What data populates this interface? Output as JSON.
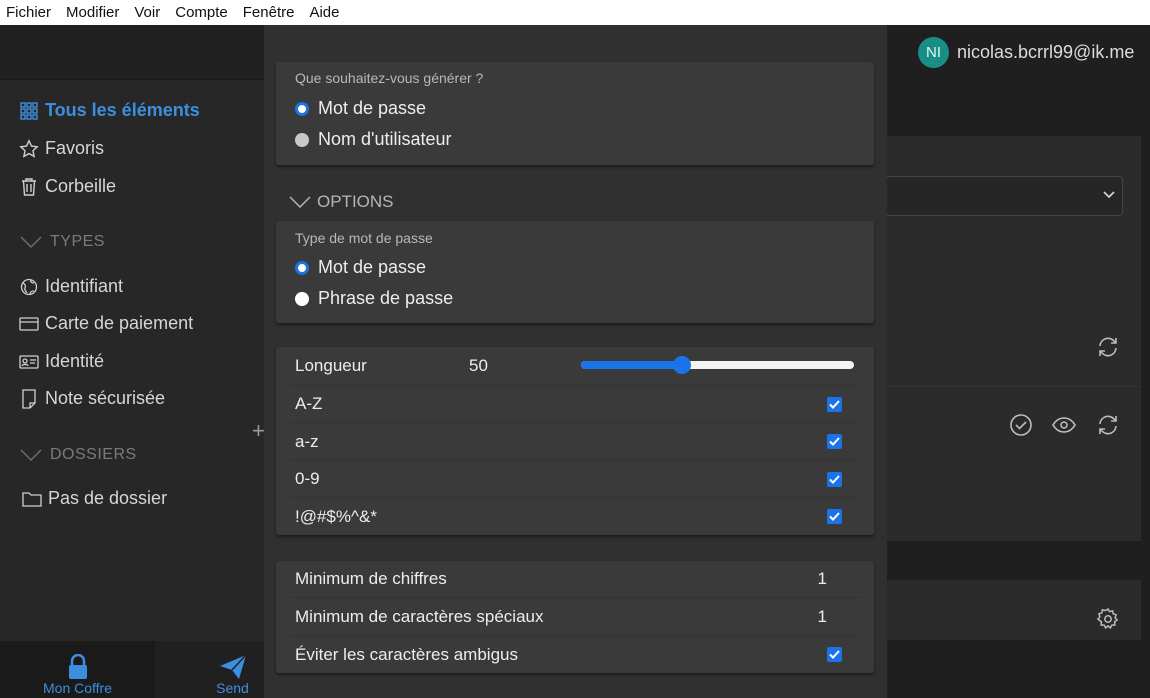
{
  "menu": [
    "Fichier",
    "Modifier",
    "Voir",
    "Compte",
    "Fenêtre",
    "Aide"
  ],
  "sidebar": {
    "all_items": "Tous les éléments",
    "favorites": "Favoris",
    "trash": "Corbeille",
    "types_title": "TYPES",
    "types": [
      "Identifiant",
      "Carte de paiement",
      "Identité",
      "Note sécurisée"
    ],
    "folders_title": "DOSSIERS",
    "no_folder": "Pas de dossier"
  },
  "bottom_nav": {
    "vault": "Mon Coffre",
    "send": "Send"
  },
  "account": {
    "initials": "NI",
    "email": "nicolas.bcrrl99@ik.me"
  },
  "generator": {
    "what_label": "Que souhaitez-vous générer ?",
    "what_options": [
      "Mot de passe",
      "Nom d'utilisateur"
    ],
    "what_selected": 0,
    "options_title": "OPTIONS",
    "type_label": "Type de mot de passe",
    "type_options": [
      "Mot de passe",
      "Phrase de passe"
    ],
    "type_selected": 0,
    "length_label": "Longueur",
    "length_value": "50",
    "length_slider_fraction": 0.37,
    "charsets": [
      {
        "label": "A-Z",
        "checked": true
      },
      {
        "label": "a-z",
        "checked": true
      },
      {
        "label": "0-9",
        "checked": true
      },
      {
        "label": "!@#$%^&*",
        "checked": true
      }
    ],
    "min_digits_label": "Minimum de chiffres",
    "min_digits_value": "1",
    "min_special_label": "Minimum de caractères spéciaux",
    "min_special_value": "1",
    "avoid_ambiguous_label": "Éviter les caractères ambigus",
    "avoid_ambiguous_checked": true
  },
  "colors": {
    "accent": "#1a73e8",
    "sidebar_active": "#3c8fde",
    "avatar": "#178f87"
  }
}
